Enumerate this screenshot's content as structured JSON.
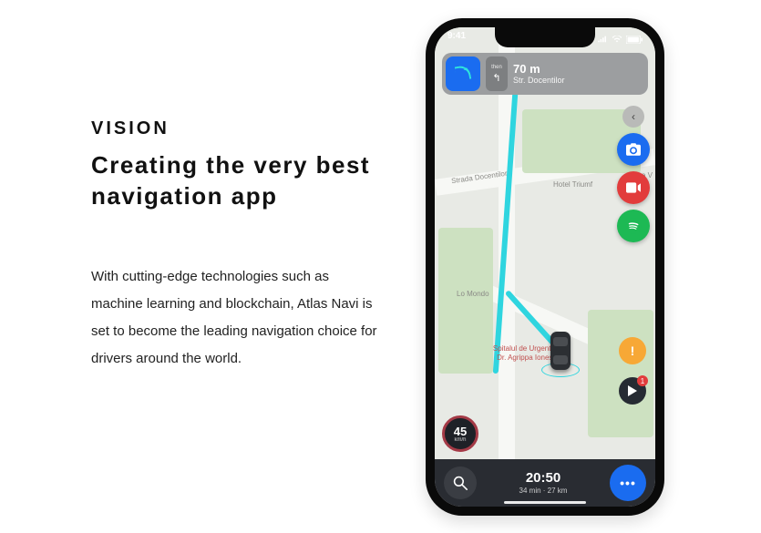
{
  "marketing": {
    "eyebrow": "VISION",
    "headline": "Creating the very best navigation app",
    "body": "With cutting-edge technologies such as machine learning and blockchain, Atlas Navi is set to become the leading navigation choice for drivers around the world."
  },
  "status": {
    "time": "9:41"
  },
  "nav": {
    "distance": "70 m",
    "street": "Str. Docentilor",
    "then_label": "then"
  },
  "map_pois": {
    "strada_docentilor": "Strada Docentilor",
    "hotel_triumf": "Hotel Triumf",
    "lo_mondo": "Lo Mondo",
    "casa_v": "Casa V",
    "hospital_line1": "Spitalul de Urgenta Pr",
    "hospital_line2": "Dr. Agrippa Ionescu"
  },
  "speed": {
    "value": "45",
    "unit": "km/h"
  },
  "bottom": {
    "eta": "20:50",
    "sub": "34 min · 27 km"
  },
  "alerts": {
    "warning_icon": "!",
    "report_count": "1"
  },
  "icons": {
    "search": "search-icon",
    "more": "more-icon",
    "camera": "camera-icon",
    "video": "video-icon",
    "spotify": "spotify-icon",
    "back": "chevron-left-icon",
    "play": "play-icon"
  }
}
